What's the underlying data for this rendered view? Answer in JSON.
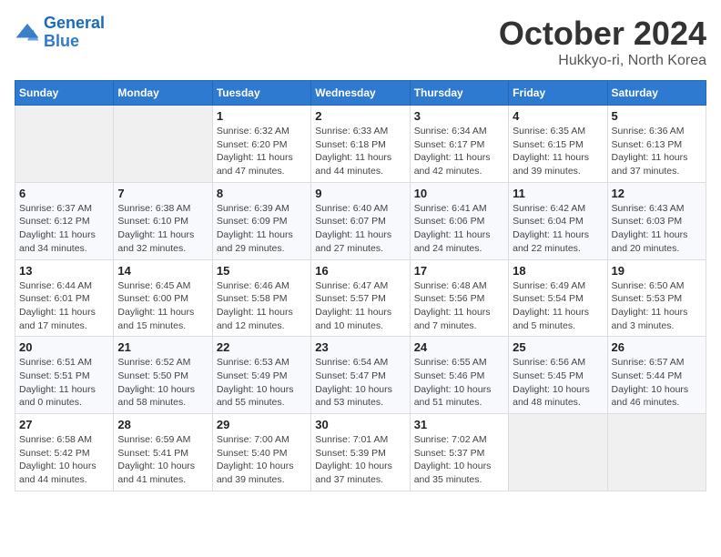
{
  "header": {
    "logo_line1": "General",
    "logo_line2": "Blue",
    "month_title": "October 2024",
    "location": "Hukkyo-ri, North Korea"
  },
  "days_of_week": [
    "Sunday",
    "Monday",
    "Tuesday",
    "Wednesday",
    "Thursday",
    "Friday",
    "Saturday"
  ],
  "weeks": [
    [
      {
        "day": "",
        "info": ""
      },
      {
        "day": "",
        "info": ""
      },
      {
        "day": "1",
        "info": "Sunrise: 6:32 AM\nSunset: 6:20 PM\nDaylight: 11 hours and 47 minutes."
      },
      {
        "day": "2",
        "info": "Sunrise: 6:33 AM\nSunset: 6:18 PM\nDaylight: 11 hours and 44 minutes."
      },
      {
        "day": "3",
        "info": "Sunrise: 6:34 AM\nSunset: 6:17 PM\nDaylight: 11 hours and 42 minutes."
      },
      {
        "day": "4",
        "info": "Sunrise: 6:35 AM\nSunset: 6:15 PM\nDaylight: 11 hours and 39 minutes."
      },
      {
        "day": "5",
        "info": "Sunrise: 6:36 AM\nSunset: 6:13 PM\nDaylight: 11 hours and 37 minutes."
      }
    ],
    [
      {
        "day": "6",
        "info": "Sunrise: 6:37 AM\nSunset: 6:12 PM\nDaylight: 11 hours and 34 minutes."
      },
      {
        "day": "7",
        "info": "Sunrise: 6:38 AM\nSunset: 6:10 PM\nDaylight: 11 hours and 32 minutes."
      },
      {
        "day": "8",
        "info": "Sunrise: 6:39 AM\nSunset: 6:09 PM\nDaylight: 11 hours and 29 minutes."
      },
      {
        "day": "9",
        "info": "Sunrise: 6:40 AM\nSunset: 6:07 PM\nDaylight: 11 hours and 27 minutes."
      },
      {
        "day": "10",
        "info": "Sunrise: 6:41 AM\nSunset: 6:06 PM\nDaylight: 11 hours and 24 minutes."
      },
      {
        "day": "11",
        "info": "Sunrise: 6:42 AM\nSunset: 6:04 PM\nDaylight: 11 hours and 22 minutes."
      },
      {
        "day": "12",
        "info": "Sunrise: 6:43 AM\nSunset: 6:03 PM\nDaylight: 11 hours and 20 minutes."
      }
    ],
    [
      {
        "day": "13",
        "info": "Sunrise: 6:44 AM\nSunset: 6:01 PM\nDaylight: 11 hours and 17 minutes."
      },
      {
        "day": "14",
        "info": "Sunrise: 6:45 AM\nSunset: 6:00 PM\nDaylight: 11 hours and 15 minutes."
      },
      {
        "day": "15",
        "info": "Sunrise: 6:46 AM\nSunset: 5:58 PM\nDaylight: 11 hours and 12 minutes."
      },
      {
        "day": "16",
        "info": "Sunrise: 6:47 AM\nSunset: 5:57 PM\nDaylight: 11 hours and 10 minutes."
      },
      {
        "day": "17",
        "info": "Sunrise: 6:48 AM\nSunset: 5:56 PM\nDaylight: 11 hours and 7 minutes."
      },
      {
        "day": "18",
        "info": "Sunrise: 6:49 AM\nSunset: 5:54 PM\nDaylight: 11 hours and 5 minutes."
      },
      {
        "day": "19",
        "info": "Sunrise: 6:50 AM\nSunset: 5:53 PM\nDaylight: 11 hours and 3 minutes."
      }
    ],
    [
      {
        "day": "20",
        "info": "Sunrise: 6:51 AM\nSunset: 5:51 PM\nDaylight: 11 hours and 0 minutes."
      },
      {
        "day": "21",
        "info": "Sunrise: 6:52 AM\nSunset: 5:50 PM\nDaylight: 10 hours and 58 minutes."
      },
      {
        "day": "22",
        "info": "Sunrise: 6:53 AM\nSunset: 5:49 PM\nDaylight: 10 hours and 55 minutes."
      },
      {
        "day": "23",
        "info": "Sunrise: 6:54 AM\nSunset: 5:47 PM\nDaylight: 10 hours and 53 minutes."
      },
      {
        "day": "24",
        "info": "Sunrise: 6:55 AM\nSunset: 5:46 PM\nDaylight: 10 hours and 51 minutes."
      },
      {
        "day": "25",
        "info": "Sunrise: 6:56 AM\nSunset: 5:45 PM\nDaylight: 10 hours and 48 minutes."
      },
      {
        "day": "26",
        "info": "Sunrise: 6:57 AM\nSunset: 5:44 PM\nDaylight: 10 hours and 46 minutes."
      }
    ],
    [
      {
        "day": "27",
        "info": "Sunrise: 6:58 AM\nSunset: 5:42 PM\nDaylight: 10 hours and 44 minutes."
      },
      {
        "day": "28",
        "info": "Sunrise: 6:59 AM\nSunset: 5:41 PM\nDaylight: 10 hours and 41 minutes."
      },
      {
        "day": "29",
        "info": "Sunrise: 7:00 AM\nSunset: 5:40 PM\nDaylight: 10 hours and 39 minutes."
      },
      {
        "day": "30",
        "info": "Sunrise: 7:01 AM\nSunset: 5:39 PM\nDaylight: 10 hours and 37 minutes."
      },
      {
        "day": "31",
        "info": "Sunrise: 7:02 AM\nSunset: 5:37 PM\nDaylight: 10 hours and 35 minutes."
      },
      {
        "day": "",
        "info": ""
      },
      {
        "day": "",
        "info": ""
      }
    ]
  ]
}
